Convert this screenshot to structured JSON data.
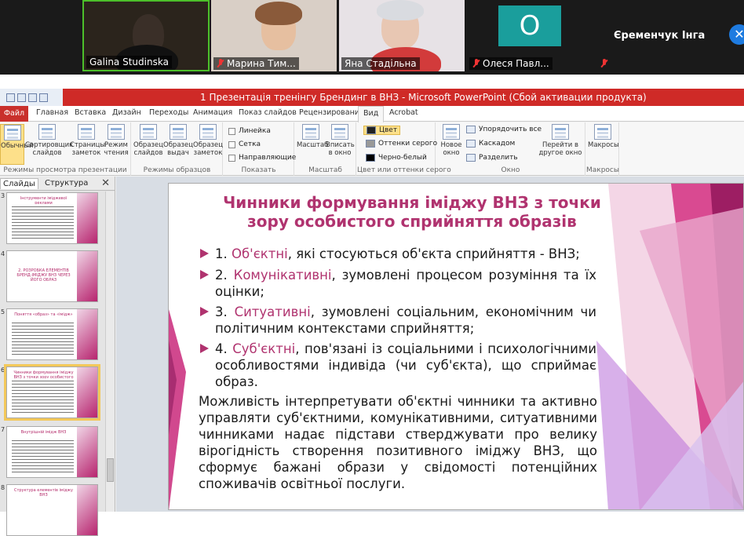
{
  "zoom": {
    "participants": [
      {
        "name": "Galina Studinska",
        "muted": false
      },
      {
        "name": "Марина Тим...",
        "muted": true
      },
      {
        "name": "Яна Стадільна",
        "muted": false
      },
      {
        "name": "Олеся Павл...",
        "muted": true,
        "avatar_letter": "О"
      },
      {
        "name": "Єременчук Інга",
        "muted": true
      }
    ]
  },
  "window": {
    "title": "1 Презентація тренінгу Брендинг в ВНЗ  -  Microsoft PowerPoint (Сбой активации продукта)"
  },
  "tabs": [
    "Файл",
    "Главная",
    "Вставка",
    "Дизайн",
    "Переходы",
    "Анимация",
    "Показ слайдов",
    "Рецензирование",
    "Вид",
    "Acrobat"
  ],
  "ribbon": {
    "views": {
      "label": "Режимы просмотра презентации",
      "buttons": [
        "Обычный",
        "Сортировщик слайдов",
        "Страницы заметок",
        "Режим чтения"
      ]
    },
    "masters": {
      "label": "Режимы образцов",
      "buttons": [
        "Образец слайдов",
        "Образец выдач",
        "Образец заметок"
      ]
    },
    "show": {
      "label": "Показать",
      "checks": [
        "Линейка",
        "Сетка",
        "Направляющие"
      ]
    },
    "zoom": {
      "label": "Масштаб",
      "buttons": [
        "Масштаб",
        "Вписать в окно"
      ]
    },
    "color": {
      "label": "Цвет или оттенки серого",
      "items": [
        "Цвет",
        "Оттенки серого",
        "Черно-белый"
      ]
    },
    "window": {
      "label": "Окно",
      "buttons": [
        "Новое окно"
      ],
      "items": [
        "Упорядочить все",
        "Каскадом",
        "Разделить"
      ],
      "switch": "Перейти в другое окно"
    },
    "macros": {
      "label": "Макросы",
      "buttons": [
        "Макросы"
      ]
    }
  },
  "left_pane": {
    "tabs": [
      "Слайды",
      "Структура"
    ],
    "close": "✕",
    "thumbs": [
      {
        "num": "3",
        "title": "Інструменти іміджевої реклами"
      },
      {
        "num": "4",
        "title": "2. РОЗРОБКА ЕЛЕМЕНТІВ БРЕНД-ІМІДЖУ ВНЗ ЧЕРЕЗ ЙОГО ОБРАЗ"
      },
      {
        "num": "5",
        "title": "Поняття «образ» та «імідж»"
      },
      {
        "num": "6",
        "title": "Чинники формування іміджу ВНЗ з точки зору особистого сприйняття образів"
      },
      {
        "num": "7",
        "title": "Внутрішній імідж ВНЗ"
      },
      {
        "num": "8",
        "title": "Структура елементів іміджу ВНЗ"
      }
    ]
  },
  "slide": {
    "title": "Чинники формування іміджу ВНЗ з точки зору особистого сприйняття образів",
    "bullets": [
      {
        "pre": "1. ",
        "kw": "Об'єктні",
        "post": ", які стосуються об'єкта сприйняття - ВНЗ;"
      },
      {
        "pre": "2. ",
        "kw": "Комунікативні",
        "post": ", зумовлені процесом розуміння та їх оцінки;"
      },
      {
        "pre": "3. ",
        "kw": "Ситуативні",
        "post": ", зумовлені соціальним, економічним чи політичним контекстами сприйняття;"
      },
      {
        "pre": "4. ",
        "kw": "Суб'єктні",
        "post": ", пов'язані із соціальними і психологічними особливостями індивіда (чи суб'єкта), що сприймає образ."
      }
    ],
    "paragraph": "Можливість інтерпретувати об'єктні чинники та активно управляти суб'єктними, комунікативними, ситуативними чинниками надає підстави стверджувати про велику вірогідність створення позитивного іміджу ВНЗ, що сформує бажані образи у свідомості потенційних споживачів освітньої послуги."
  },
  "colors": {
    "accent": "#b0336f",
    "titlebar": "#cf2a27"
  }
}
